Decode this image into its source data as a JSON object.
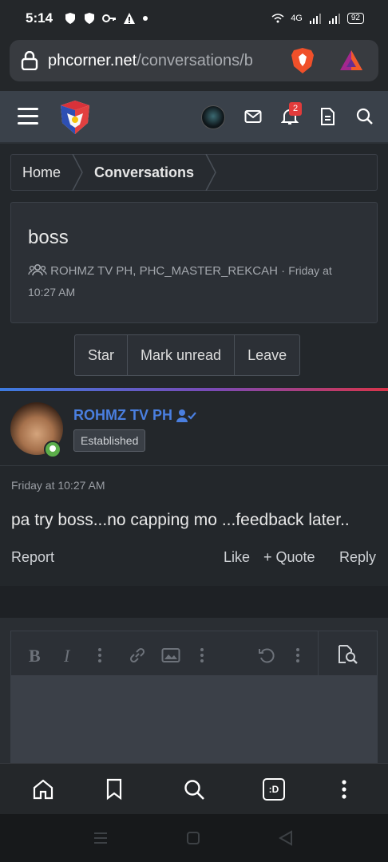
{
  "status_bar": {
    "time": "5:14",
    "battery": "92",
    "network": "4G"
  },
  "browser": {
    "url_host": "phcorner.net",
    "url_path": "/conversations/b"
  },
  "header": {
    "notification_count": "2"
  },
  "breadcrumb": {
    "items": [
      "Home",
      "Conversations"
    ]
  },
  "conversation": {
    "title": "boss",
    "participants": "ROHMZ TV PH, PHC_MASTER_REKCAH",
    "separator": "·",
    "date": "Friday at 10:27 AM"
  },
  "actions": {
    "star": "Star",
    "mark_unread": "Mark unread",
    "leave": "Leave"
  },
  "message": {
    "author": "ROHMZ TV PH",
    "badge": "Established",
    "date": "Friday at 10:27 AM",
    "body": "pa try boss...no capping mo ...feedback later..",
    "report": "Report",
    "like": "Like",
    "quote": "+ Quote",
    "reply": "Reply"
  },
  "editor": {
    "bold_label": "B",
    "italic_label": "I"
  },
  "bottom_nav": {
    "tabs_label": ":D"
  },
  "colors": {
    "username": "#4a7fe0",
    "online": "#5cae4a",
    "badge_red": "#e23b3b"
  }
}
